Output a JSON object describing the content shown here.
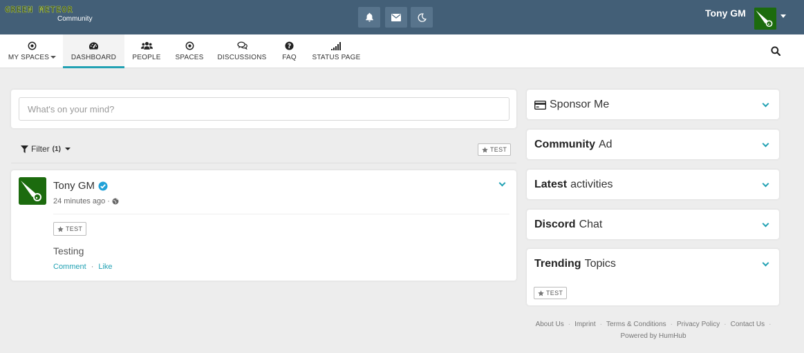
{
  "brand": {
    "logo_text": "GREEN METEOR",
    "subtitle": "Community"
  },
  "header": {
    "icons": [
      "bell-icon",
      "envelope-icon",
      "moon-icon"
    ],
    "user_name": "Tony GM",
    "bar_color": "#435f77",
    "accent_color": "#21a1b3"
  },
  "nav": {
    "items": [
      {
        "label": "MY SPACES",
        "icon": "target-icon"
      },
      {
        "label": "DASHBOARD",
        "icon": "tachometer-icon",
        "active": true
      },
      {
        "label": "PEOPLE",
        "icon": "users-icon"
      },
      {
        "label": "SPACES",
        "icon": "target-icon"
      },
      {
        "label": "DISCUSSIONS",
        "icon": "comments-icon"
      },
      {
        "label": "FAQ",
        "icon": "question-icon"
      },
      {
        "label": "STATUS PAGE",
        "icon": "signal-icon"
      }
    ]
  },
  "composer": {
    "placeholder": "What's on your mind?"
  },
  "filter": {
    "label": "Filter",
    "count": "(1)",
    "active_tag": "TEST"
  },
  "post": {
    "author": "Tony GM",
    "time": "24 minutes ago",
    "topic": "TEST",
    "text": "Testing",
    "comment_label": "Comment",
    "like_label": "Like",
    "dot": "·"
  },
  "sidebar": {
    "panels": [
      {
        "bold": "",
        "rest": "Sponsor Me",
        "icon": "credit-card-icon"
      },
      {
        "bold": "Community",
        "rest": "Ad"
      },
      {
        "bold": "Latest",
        "rest": "activities"
      },
      {
        "bold": "Discord",
        "rest": "Chat"
      },
      {
        "bold": "Trending",
        "rest": "Topics",
        "tag": "TEST"
      }
    ]
  },
  "footer": {
    "links": [
      "About Us",
      "Imprint",
      "Terms & Conditions",
      "Privacy Policy",
      "Contact Us"
    ],
    "powered": "Powered by HumHub",
    "sep": "·"
  }
}
